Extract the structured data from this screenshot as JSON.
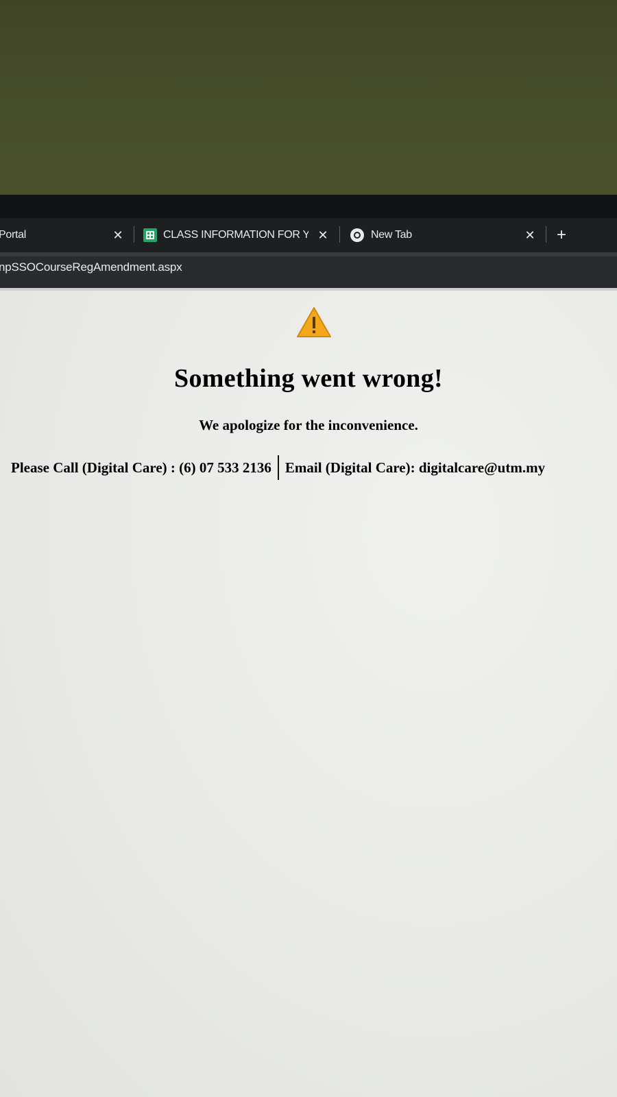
{
  "tabs": [
    {
      "title": "Portal",
      "icon": "none",
      "active": false
    },
    {
      "title": "CLASS INFORMATION FOR YEA",
      "icon": "google-sheets-icon",
      "active": false
    },
    {
      "title": "New Tab",
      "icon": "chrome-icon",
      "active": true
    }
  ],
  "tab_close_glyph": "✕",
  "new_tab_glyph": "+",
  "address_bar": {
    "url": "npSSOCourseRegAmendment.aspx"
  },
  "error_page": {
    "icon": "warning-triangle-icon",
    "title": "Something went wrong!",
    "subtitle": "We apologize for the inconvenience.",
    "call_text": "Please Call (Digital Care) : (6) 07 533 2136",
    "email_text": "Email (Digital Care): digitalcare@utm.my"
  },
  "colors": {
    "tabstrip_bg": "#1e1f21",
    "warning_fill": "#f2a71c",
    "sheets_green": "#23a566",
    "page_bg": "#e9eae7"
  }
}
